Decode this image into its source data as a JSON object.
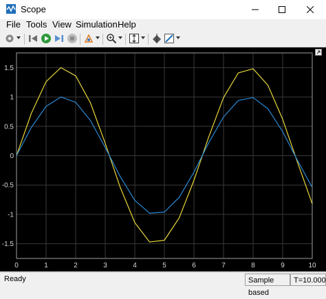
{
  "window": {
    "title": "Scope"
  },
  "menu": {
    "items": [
      "File",
      "Tools",
      "View",
      "Simulation",
      "Help"
    ]
  },
  "toolbar": {
    "icons": [
      "gear-icon",
      "rewind-icon",
      "run-icon",
      "step-forward-icon",
      "stop-icon",
      "highlight-icon",
      "zoom-icon",
      "fit-axes-icon",
      "cursor-measure-icon",
      "style-icon"
    ]
  },
  "chart_data": {
    "type": "line",
    "xlim": [
      0,
      10
    ],
    "ylim": [
      -1.75,
      1.75
    ],
    "x_ticks": [
      0,
      1,
      2,
      3,
      4,
      5,
      6,
      7,
      8,
      9,
      10
    ],
    "y_ticks": [
      1.5,
      1,
      0.5,
      0,
      -0.5,
      -1,
      -1.5
    ],
    "x_tick_labels": [
      "0",
      "1",
      "2",
      "3",
      "4",
      "5",
      "6",
      "7",
      "8",
      "9",
      "10"
    ],
    "y_tick_labels": [
      "1.5",
      "1",
      "0.5",
      "0",
      "-0.5",
      "-1",
      "-1.5"
    ],
    "grid": true,
    "series": [
      {
        "color": "#e8d63a",
        "x": [
          0,
          0.5,
          1,
          1.5,
          2,
          2.5,
          3,
          3.5,
          4,
          4.5,
          5,
          5.5,
          6,
          6.5,
          7,
          7.5,
          8,
          8.5,
          9,
          9.5,
          10
        ],
        "values": [
          0,
          0.72,
          1.26,
          1.5,
          1.36,
          0.9,
          0.21,
          -0.53,
          -1.14,
          -1.47,
          -1.44,
          -1.06,
          -0.42,
          0.32,
          0.99,
          1.41,
          1.48,
          1.2,
          0.62,
          -0.11,
          -0.82
        ]
      },
      {
        "color": "#2a8ad6",
        "x": [
          0,
          0.5,
          1,
          1.5,
          2,
          2.5,
          3,
          3.5,
          4,
          4.5,
          5,
          5.5,
          6,
          6.5,
          7,
          7.5,
          8,
          8.5,
          9,
          9.5,
          10
        ],
        "values": [
          0,
          0.48,
          0.84,
          1.0,
          0.91,
          0.6,
          0.14,
          -0.35,
          -0.76,
          -0.98,
          -0.96,
          -0.71,
          -0.28,
          0.22,
          0.66,
          0.94,
          0.99,
          0.8,
          0.41,
          -0.08,
          -0.54
        ]
      }
    ]
  },
  "status": {
    "left": "Ready",
    "mode": "Sample based",
    "time": "T=10.000"
  }
}
